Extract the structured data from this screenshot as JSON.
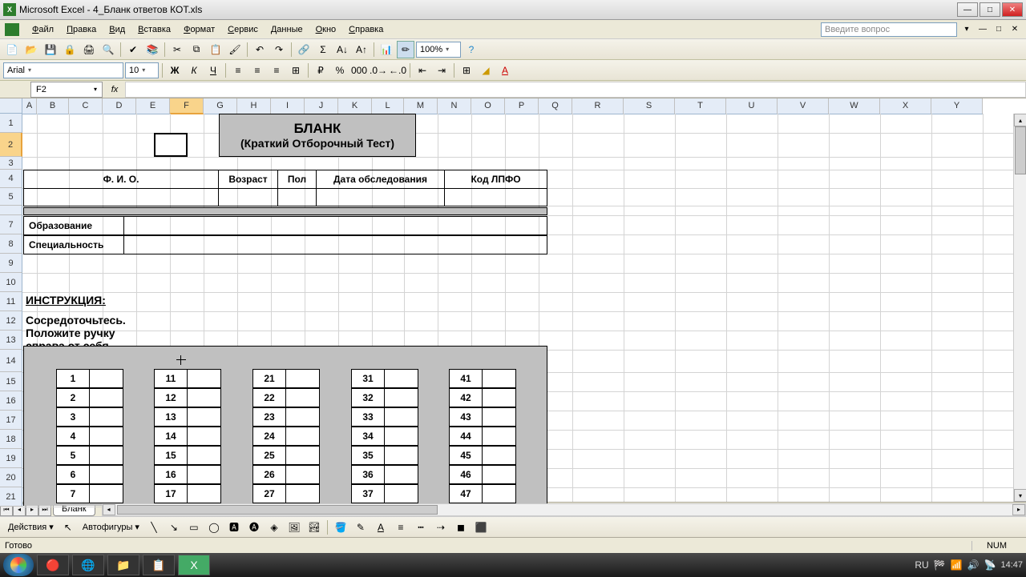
{
  "app": {
    "name": "Microsoft Excel",
    "doc": "4_Бланк ответов КОТ.xls",
    "title": "Microsoft Excel - 4_Бланк ответов КОТ.xls"
  },
  "menu": [
    "Файл",
    "Правка",
    "Вид",
    "Вставка",
    "Формат",
    "Сервис",
    "Данные",
    "Окно",
    "Справка"
  ],
  "help_placeholder": "Введите вопрос",
  "font": {
    "name": "Arial",
    "size": "10"
  },
  "zoom": "100%",
  "namebox": "F2",
  "formula": "",
  "columns": [
    {
      "l": "A",
      "w": 18
    },
    {
      "l": "B",
      "w": 40
    },
    {
      "l": "C",
      "w": 42
    },
    {
      "l": "D",
      "w": 42
    },
    {
      "l": "E",
      "w": 42
    },
    {
      "l": "F",
      "w": 42
    },
    {
      "l": "G",
      "w": 42
    },
    {
      "l": "H",
      "w": 42
    },
    {
      "l": "I",
      "w": 42
    },
    {
      "l": "J",
      "w": 42
    },
    {
      "l": "K",
      "w": 42
    },
    {
      "l": "L",
      "w": 40
    },
    {
      "l": "M",
      "w": 42
    },
    {
      "l": "N",
      "w": 42
    },
    {
      "l": "O",
      "w": 42
    },
    {
      "l": "P",
      "w": 42
    },
    {
      "l": "Q",
      "w": 42
    },
    {
      "l": "R",
      "w": 64
    },
    {
      "l": "S",
      "w": 64
    },
    {
      "l": "T",
      "w": 64
    },
    {
      "l": "U",
      "w": 64
    },
    {
      "l": "V",
      "w": 64
    },
    {
      "l": "W",
      "w": 64
    },
    {
      "l": "X",
      "w": 64
    },
    {
      "l": "Y",
      "w": 64
    }
  ],
  "rows": [
    {
      "n": 1,
      "h": 24
    },
    {
      "n": 2,
      "h": 30
    },
    {
      "n": 3,
      "h": 16
    },
    {
      "n": 4,
      "h": 23
    },
    {
      "n": 5,
      "h": 22
    },
    {
      "n": "",
      "h": 12
    },
    {
      "n": 7,
      "h": 24
    },
    {
      "n": 8,
      "h": 24
    },
    {
      "n": 9,
      "h": 24
    },
    {
      "n": 10,
      "h": 24
    },
    {
      "n": 11,
      "h": 24
    },
    {
      "n": 12,
      "h": 24
    },
    {
      "n": 13,
      "h": 24
    },
    {
      "n": 14,
      "h": 28
    },
    {
      "n": 15,
      "h": 24
    },
    {
      "n": 16,
      "h": 24
    },
    {
      "n": 17,
      "h": 24
    },
    {
      "n": 18,
      "h": 24
    },
    {
      "n": 19,
      "h": 24
    },
    {
      "n": 20,
      "h": 24
    },
    {
      "n": 21,
      "h": 24
    }
  ],
  "selected_col": "F",
  "selected_row": 2,
  "title_block": {
    "line1": "БЛАНК",
    "line2": "(Краткий Отборочный Тест)"
  },
  "info_headers": {
    "fio": "Ф. И. О.",
    "age": "Возраст",
    "sex": "Пол",
    "date": "Дата обследования",
    "code": "Код ЛПФО"
  },
  "edu_label": "Образование",
  "spec_label": "Специальность",
  "instruction_title": "ИНСТРУКЦИЯ:",
  "instruction_text": "Сосредоточьтесь. Положите ручку справа от себя. Ждите команды.",
  "answer_cols": [
    [
      1,
      2,
      3,
      4,
      5,
      6,
      7
    ],
    [
      11,
      12,
      13,
      14,
      15,
      16,
      17
    ],
    [
      21,
      22,
      23,
      24,
      25,
      26,
      27
    ],
    [
      31,
      32,
      33,
      34,
      35,
      36,
      37
    ],
    [
      41,
      42,
      43,
      44,
      45,
      46,
      47
    ]
  ],
  "sheet_tab": "Бланк",
  "drawbar": {
    "actions": "Действия",
    "autoshapes": "Автофигуры"
  },
  "status": {
    "ready": "Готово",
    "num": "NUM"
  },
  "tray": {
    "lang": "RU",
    "time": "14:47"
  }
}
